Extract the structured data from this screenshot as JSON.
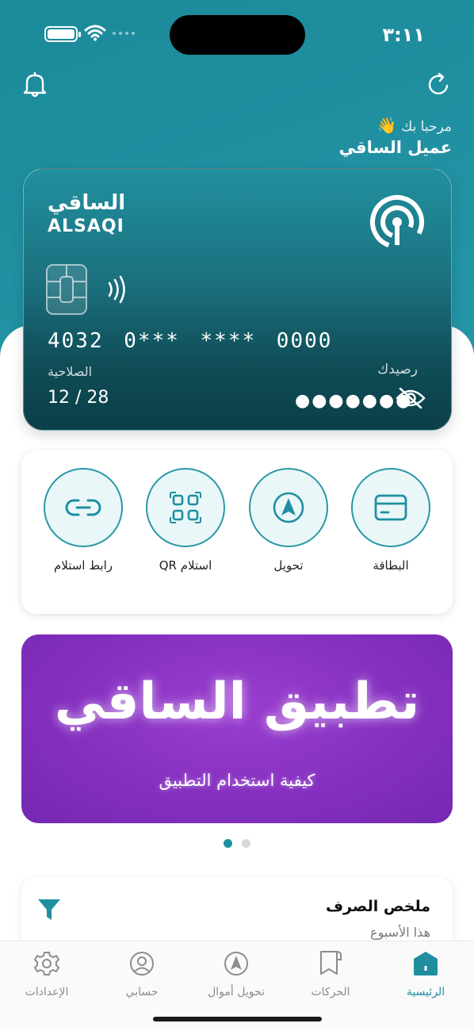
{
  "status_bar": {
    "time": "٣:١١"
  },
  "header": {
    "greeting": "مرحبا بك",
    "greeting_emoji": "👋",
    "user_name": "عميل الساقي",
    "notifications_icon": "bell-icon",
    "refresh_icon": "refresh-icon"
  },
  "card": {
    "brand_ar": "الساقي",
    "brand_en": "ALSAQI",
    "number": "4032 0*** **** 0000",
    "validity_label": "الصلاحية",
    "validity_value": "12 / 28",
    "balance_label": "رصيدك",
    "balance_masked": "●●●●●●●"
  },
  "quick_actions": [
    {
      "label": "رابط استلام",
      "icon": "link-icon"
    },
    {
      "label": "استلام QR",
      "icon": "qr-scan-icon"
    },
    {
      "label": "تحويل",
      "icon": "navigation-arrow-icon"
    },
    {
      "label": "البطاقة",
      "icon": "card-icon"
    }
  ],
  "banner": {
    "title": "تطبيق الساقي",
    "subtitle": "كيفية استخدام التطبيق",
    "pages": 2,
    "active_page": 1
  },
  "summary": {
    "title": "ملخص الصرف",
    "period": "هذا الأسبوع"
  },
  "tab_bar": {
    "items": [
      {
        "label": "الإعدادات",
        "icon": "gear-icon"
      },
      {
        "label": "حسابي",
        "icon": "user-icon"
      },
      {
        "label": "تحويل أموال",
        "icon": "transfer-icon"
      },
      {
        "label": "الحركات",
        "icon": "transactions-icon"
      },
      {
        "label": "الرئيسية",
        "icon": "home-icon"
      }
    ],
    "active": "الرئيسية"
  },
  "colors": {
    "primary": "#1f8fa0",
    "card_dark": "#0b3f48",
    "banner_purple": "#8530c0"
  }
}
